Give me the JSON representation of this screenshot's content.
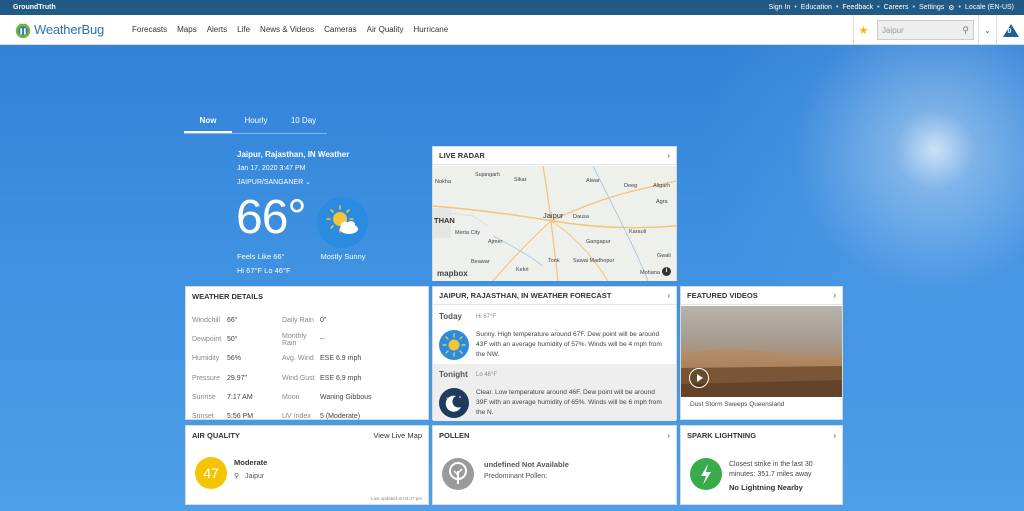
{
  "topbar": {
    "brand": "GroundTruth",
    "links": [
      "Sign In",
      "Education",
      "Feedback",
      "Careers",
      "Settings",
      "Locale (EN-US)"
    ],
    "separator": "•"
  },
  "nav": {
    "logo_text": "WeatherBug",
    "items": [
      "Forecasts",
      "Maps",
      "Alerts",
      "Life",
      "News & Videos",
      "Cameras",
      "Air Quality",
      "Hurricane"
    ],
    "search_value": "Jaipur",
    "alerts_count": "0"
  },
  "tabs": [
    "Now",
    "Hourly",
    "10 Day"
  ],
  "current": {
    "location": "Jaipur, Rajasthan, IN Weather",
    "datetime": "Jan 17, 2020  3:47 PM",
    "station": "JAIPUR/SANGANER",
    "temperature": "66°",
    "feels_like": "Feels Like  66°",
    "hi_lo": "Hi 67°F   Lo 46°F",
    "condition": "Mostly Sunny"
  },
  "radar": {
    "title": "LIVE RADAR",
    "labels": [
      "Nokha",
      "Sujangarh",
      "Sikar",
      "Alwar",
      "Deeg",
      "Aligarh",
      "Jaipur",
      "Dausa",
      "Agra",
      "Merta City",
      "Ajmer",
      "Gangapur",
      "Beawar",
      "Tonk",
      "Sawai Madhopur",
      "Kekri",
      "Gwali",
      "Mohana",
      "Karauli",
      "THAN"
    ],
    "attribution": "mapbox"
  },
  "weather_details": {
    "title": "WEATHER DETAILS",
    "rows": [
      {
        "k1": "Windchill",
        "v1": "66°",
        "k2": "Daily Rain",
        "v2": "0\""
      },
      {
        "k1": "Dewpoint",
        "v1": "50°",
        "k2": "Monthly Rain",
        "v2": "--"
      },
      {
        "k1": "Humidity",
        "v1": "56%",
        "k2": "Avg. Wind",
        "v2": "ESE 6.9 mph"
      },
      {
        "k1": "Pressure",
        "v1": "29.97\"",
        "k2": "Wind Gust",
        "v2": "ESE 6.9 mph"
      },
      {
        "k1": "Sunrise",
        "v1": "7:17 AM",
        "k2": "Moon",
        "v2": "Waning Gibbous"
      },
      {
        "k1": "Sunset",
        "v1": "5:56 PM",
        "k2": "UV Index",
        "v2": "5 (Moderate)"
      }
    ]
  },
  "forecast": {
    "title": "JAIPUR, RAJASTHAN, IN WEATHER FORECAST",
    "periods": [
      {
        "name": "Today",
        "hl": "Hi 67°F",
        "text": "Sunny. High temperature around 67F. Dew point will be around 43F with an average humidity of 57%. Winds will be 4 mph from the NW."
      },
      {
        "name": "Tonight",
        "hl": "Lo 46°F",
        "text": "Clear. Low temperature around 46F. Dew point will be around 39F with an average humidity of 65%. Winds will be 6 mph from the N."
      }
    ]
  },
  "featured": {
    "title": "FEATURED VIDEOS",
    "caption": "Dust Storm Sweeps Queensland"
  },
  "air_quality": {
    "title": "AIR QUALITY",
    "link": "View Live Map",
    "aqi": "47",
    "level": "Moderate",
    "location": "Jaipur",
    "updated": "Last updated at 03:47 pm",
    "color": "#f5c400"
  },
  "pollen": {
    "title": "POLLEN",
    "status": "undefined Not Available",
    "predominant": "Predominant Pollen:"
  },
  "spark": {
    "title": "SPARK LIGHTNING",
    "closest": "Closest strike in the last 30 minutes: 351.7 miles away",
    "status": "No Lightning Nearby",
    "color": "#3aab4a"
  }
}
